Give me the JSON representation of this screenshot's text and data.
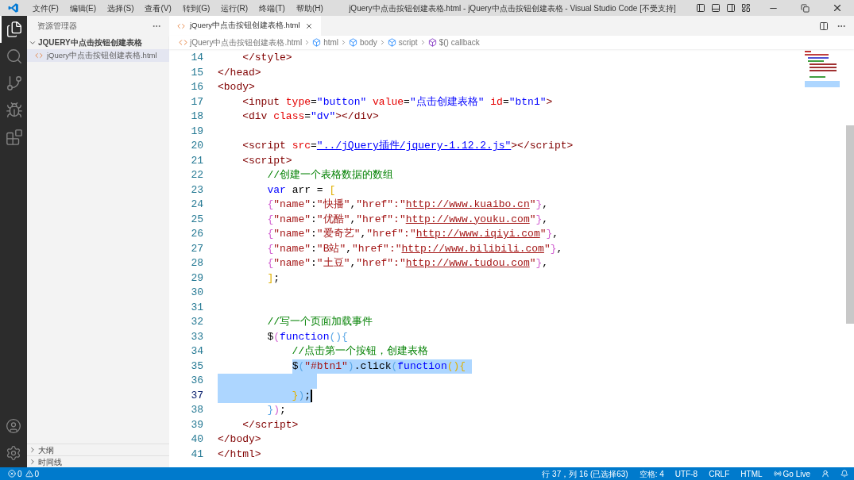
{
  "window": {
    "title": "jQuery中点击按钮创建表格.html - jQuery中点击按钮创建表格 - Visual Studio Code [不受支持]"
  },
  "menu": [
    "文件(F)",
    "编辑(E)",
    "选择(S)",
    "查看(V)",
    "转到(G)",
    "运行(R)",
    "终端(T)",
    "帮助(H)"
  ],
  "activity_bar": [
    {
      "kind": "files",
      "selected": true
    },
    {
      "kind": "search",
      "selected": false
    },
    {
      "kind": "git",
      "selected": false
    },
    {
      "kind": "debug",
      "selected": false
    },
    {
      "kind": "extensions",
      "selected": false
    }
  ],
  "sidebar": {
    "title": "资源管理器",
    "folder": {
      "name": "JQUERY中点击按钮创建表格",
      "expanded": true,
      "files": [
        {
          "name": "jQuery中点击按钮创建表格.html",
          "selected": true
        }
      ]
    },
    "sections": [
      {
        "name": "大纲",
        "expanded": false
      },
      {
        "name": "时间线",
        "expanded": false
      }
    ]
  },
  "tabs": [
    {
      "label": "jQuery中点击按钮创建表格.html",
      "selected": true
    }
  ],
  "breadcrumb": [
    {
      "label": "jQuery中点击按钮创建表格.html",
      "kind": "file"
    },
    {
      "label": "html",
      "kind": "element"
    },
    {
      "label": "body",
      "kind": "element"
    },
    {
      "label": "script",
      "kind": "element"
    },
    {
      "label": "$() callback",
      "kind": "function"
    }
  ],
  "editor": {
    "lines": [
      {
        "n": "14",
        "selected": false,
        "tokens": [
          {
            "text": "    </style>",
            "kind": "tag"
          }
        ]
      },
      {
        "n": "15",
        "selected": false,
        "tokens": [
          {
            "text": "</head>",
            "kind": "tag"
          }
        ]
      },
      {
        "n": "16",
        "selected": false,
        "tokens": [
          {
            "text": "<body>",
            "kind": "tag"
          }
        ]
      },
      {
        "n": "17",
        "selected": false,
        "tokens": [
          {
            "text": "    <input",
            "kind": "tag"
          },
          {
            "text": " type",
            "kind": "attr"
          },
          {
            "text": "=",
            "kind": "plain"
          },
          {
            "text": "\"button\"",
            "kind": "value"
          },
          {
            "text": " value",
            "kind": "attr"
          },
          {
            "text": "=",
            "kind": "plain"
          },
          {
            "text": "\"点击创建表格\"",
            "kind": "value"
          },
          {
            "text": " id",
            "kind": "attr"
          },
          {
            "text": "=",
            "kind": "plain"
          },
          {
            "text": "\"btn1\"",
            "kind": "value"
          },
          {
            "text": ">",
            "kind": "tag"
          }
        ]
      },
      {
        "n": "18",
        "selected": false,
        "tokens": [
          {
            "text": "    <div",
            "kind": "tag"
          },
          {
            "text": " class",
            "kind": "attr"
          },
          {
            "text": "=",
            "kind": "plain"
          },
          {
            "text": "\"dv\"",
            "kind": "value"
          },
          {
            "text": "></div>",
            "kind": "tag"
          }
        ]
      },
      {
        "n": "19",
        "selected": false
      },
      {
        "n": "20",
        "selected": false,
        "tokens": [
          {
            "text": "    <script",
            "kind": "tag"
          },
          {
            "text": " src",
            "kind": "attr"
          },
          {
            "text": "=",
            "kind": "plain"
          },
          {
            "text": "\"../jQuery插件/jquery-1.12.2.js\"",
            "kind": "link_value"
          },
          {
            "text": "></script>",
            "kind": "tag"
          }
        ]
      },
      {
        "n": "21",
        "selected": false,
        "tokens": [
          {
            "text": "    <script>",
            "kind": "tag"
          }
        ]
      },
      {
        "n": "22",
        "selected": false,
        "tokens": [
          {
            "text": "        //创建一个表格数据的数组",
            "kind": "comment"
          }
        ]
      },
      {
        "n": "23",
        "selected": false,
        "tokens": [
          {
            "text": "        var",
            "kind": "keyword"
          },
          {
            "text": " arr = ",
            "kind": "plain"
          },
          {
            "text": "[",
            "kind": "bracket1"
          }
        ]
      },
      {
        "n": "24",
        "selected": false,
        "tokens": [
          {
            "text": "        {",
            "kind": "bracket2"
          },
          {
            "text": "\"name\"",
            "kind": "string"
          },
          {
            "text": ":",
            "kind": "plain"
          },
          {
            "text": "\"快播\"",
            "kind": "string"
          },
          {
            "text": ",",
            "kind": "plain"
          },
          {
            "text": "\"href\"",
            "kind": "string"
          },
          {
            "text": ":\"",
            "kind": "string"
          },
          {
            "text": "http://www.kuaibo.cn",
            "kind": "link_string"
          },
          {
            "text": "\"",
            "kind": "string"
          },
          {
            "text": "}",
            "kind": "bracket2"
          },
          {
            "text": ",",
            "kind": "plain"
          }
        ]
      },
      {
        "n": "25",
        "selected": false,
        "tokens": [
          {
            "text": "        {",
            "kind": "bracket2"
          },
          {
            "text": "\"name\"",
            "kind": "string"
          },
          {
            "text": ":",
            "kind": "plain"
          },
          {
            "text": "\"优酷\"",
            "kind": "string"
          },
          {
            "text": ",",
            "kind": "plain"
          },
          {
            "text": "\"href\"",
            "kind": "string"
          },
          {
            "text": ":\"",
            "kind": "string"
          },
          {
            "text": "http://www.youku.com",
            "kind": "link_string"
          },
          {
            "text": "\"",
            "kind": "string"
          },
          {
            "text": "}",
            "kind": "bracket2"
          },
          {
            "text": ",",
            "kind": "plain"
          }
        ]
      },
      {
        "n": "26",
        "selected": false,
        "tokens": [
          {
            "text": "        {",
            "kind": "bracket2"
          },
          {
            "text": "\"name\"",
            "kind": "string"
          },
          {
            "text": ":",
            "kind": "plain"
          },
          {
            "text": "\"爱奇艺\"",
            "kind": "string"
          },
          {
            "text": ",",
            "kind": "plain"
          },
          {
            "text": "\"href\"",
            "kind": "string"
          },
          {
            "text": ":\"",
            "kind": "string"
          },
          {
            "text": "http://www.iqiyi.com",
            "kind": "link_string"
          },
          {
            "text": "\"",
            "kind": "string"
          },
          {
            "text": "}",
            "kind": "bracket2"
          },
          {
            "text": ",",
            "kind": "plain"
          }
        ]
      },
      {
        "n": "27",
        "selected": false,
        "tokens": [
          {
            "text": "        {",
            "kind": "bracket2"
          },
          {
            "text": "\"name\"",
            "kind": "string"
          },
          {
            "text": ":",
            "kind": "plain"
          },
          {
            "text": "\"B站\"",
            "kind": "string"
          },
          {
            "text": ",",
            "kind": "plain"
          },
          {
            "text": "\"href\"",
            "kind": "string"
          },
          {
            "text": ":\"",
            "kind": "string"
          },
          {
            "text": "http://www.bilibili.com",
            "kind": "link_string"
          },
          {
            "text": "\"",
            "kind": "string"
          },
          {
            "text": "}",
            "kind": "bracket2"
          },
          {
            "text": ",",
            "kind": "plain"
          }
        ]
      },
      {
        "n": "28",
        "selected": false,
        "tokens": [
          {
            "text": "        {",
            "kind": "bracket2"
          },
          {
            "text": "\"name\"",
            "kind": "string"
          },
          {
            "text": ":",
            "kind": "plain"
          },
          {
            "text": "\"土豆\"",
            "kind": "string"
          },
          {
            "text": ",",
            "kind": "plain"
          },
          {
            "text": "\"href\"",
            "kind": "string"
          },
          {
            "text": ":\"",
            "kind": "string"
          },
          {
            "text": "http://www.tudou.com",
            "kind": "link_string"
          },
          {
            "text": "\"",
            "kind": "string"
          },
          {
            "text": "}",
            "kind": "bracket2"
          },
          {
            "text": ",",
            "kind": "plain"
          }
        ]
      },
      {
        "n": "29",
        "selected": false,
        "tokens": [
          {
            "text": "        ]",
            "kind": "bracket1"
          },
          {
            "text": ";",
            "kind": "plain"
          }
        ]
      },
      {
        "n": "30",
        "selected": false
      },
      {
        "n": "31",
        "selected": false
      },
      {
        "n": "32",
        "selected": false,
        "tokens": [
          {
            "text": "        //写一个页面加载事件",
            "kind": "comment"
          }
        ]
      },
      {
        "n": "33",
        "selected": false,
        "tokens": [
          {
            "text": "        $",
            "kind": "plain"
          },
          {
            "text": "(",
            "kind": "bracket2"
          },
          {
            "text": "function",
            "kind": "keyword"
          },
          {
            "text": "(){",
            "kind": "bracket3"
          }
        ]
      },
      {
        "n": "34",
        "selected": false,
        "tokens": [
          {
            "text": "            //点击第一个按钮，创建表格",
            "kind": "comment"
          }
        ]
      },
      {
        "n": "35",
        "selected": true,
        "tokens": [
          {
            "text": "            $",
            "kind": "plain"
          },
          {
            "text": "(",
            "kind": "bracket3"
          },
          {
            "text": "\"#btn1\"",
            "kind": "string"
          },
          {
            "text": ")",
            "kind": "bracket3"
          },
          {
            "text": ".click",
            "kind": "plain"
          },
          {
            "text": "(",
            "kind": "bracket3"
          },
          {
            "text": "function",
            "kind": "keyword"
          },
          {
            "text": "(){",
            "kind": "bracket1"
          }
        ]
      },
      {
        "n": "36",
        "selected": true
      },
      {
        "n": "37",
        "selected": true,
        "cursor": true,
        "tokens": [
          {
            "text": "            }",
            "kind": "bracket1"
          },
          {
            "text": ")",
            "kind": "bracket3"
          },
          {
            "text": ";",
            "kind": "plain"
          }
        ]
      },
      {
        "n": "38",
        "selected": false,
        "tokens": [
          {
            "text": "        }",
            "kind": "bracket3"
          },
          {
            "text": ")",
            "kind": "bracket2"
          },
          {
            "text": ";",
            "kind": "plain"
          }
        ]
      },
      {
        "n": "39",
        "selected": false,
        "tokens": [
          {
            "text": "    </script>",
            "kind": "tag"
          }
        ]
      },
      {
        "n": "40",
        "selected": false,
        "tokens": [
          {
            "text": "</body>",
            "kind": "tag"
          }
        ]
      },
      {
        "n": "41",
        "selected": false,
        "tokens": [
          {
            "text": "</html>",
            "kind": "tag"
          }
        ]
      }
    ]
  },
  "status_bar": {
    "errors": "0",
    "warnings": "0",
    "items": [
      {
        "label": "行 37，列 16 (已选择63)",
        "kind": "text"
      },
      {
        "label": "空格: 4",
        "kind": "text"
      },
      {
        "label": "UTF-8",
        "kind": "text"
      },
      {
        "label": "CRLF",
        "kind": "text"
      },
      {
        "label": "HTML",
        "kind": "text"
      },
      {
        "label": "Go Live",
        "kind": "live"
      }
    ]
  }
}
